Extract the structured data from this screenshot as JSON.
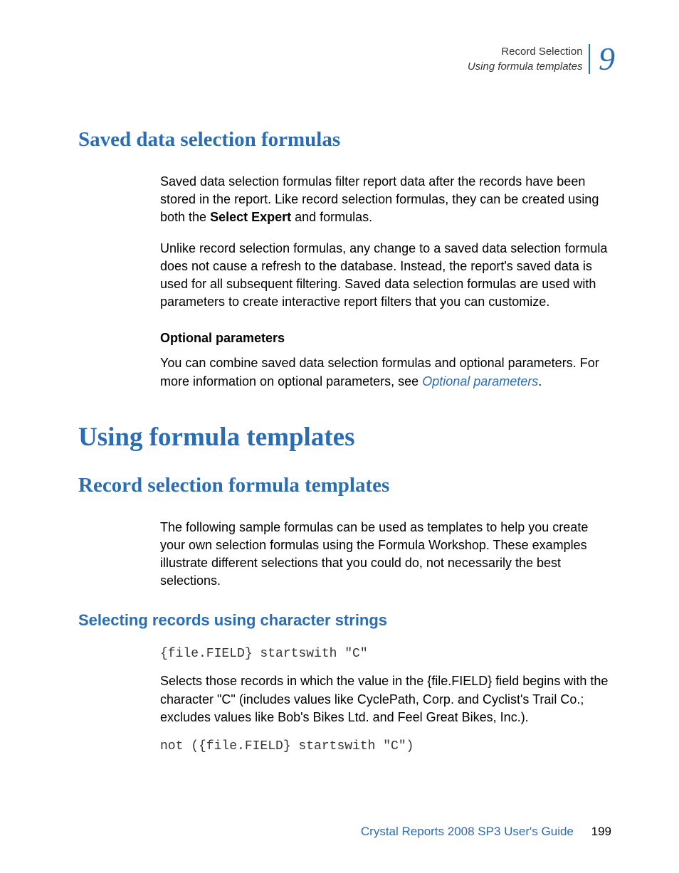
{
  "header": {
    "line1": "Record Selection",
    "line2": "Using formula templates",
    "chapter": "9"
  },
  "section1": {
    "title": "Saved data selection formulas",
    "p1_a": "Saved data selection formulas filter report data after the records have been stored in the report. Like record selection formulas, they can be created using both the ",
    "p1_bold": "Select Expert",
    "p1_b": " and formulas.",
    "p2": "Unlike record selection formulas, any change to a saved data selection formula does not cause a refresh to the database. Instead, the report's saved data is used for all subsequent filtering. Saved data selection formulas are used with parameters to create interactive report filters that you can customize.",
    "sub1": "Optional parameters",
    "p3_a": "You can combine saved data selection formulas and optional parameters. For more information on optional parameters, see ",
    "p3_link": "Optional parameters",
    "p3_b": "."
  },
  "section2": {
    "title": "Using formula templates",
    "subtitle": "Record selection formula templates",
    "p1": "The following sample formulas can be used as templates to help you create your own selection formulas using the Formula Workshop. These examples illustrate different selections that you could do, not necessarily the best selections.",
    "sub1": "Selecting records using character strings",
    "code1": "{file.FIELD} startswith \"C\"",
    "p2": "Selects those records in which the value in the {file.FIELD} field begins with the character \"C\" (includes values like CyclePath, Corp. and Cyclist's Trail Co.; excludes values like Bob's Bikes Ltd. and Feel Great Bikes, Inc.).",
    "code2": "not ({file.FIELD} startswith \"C\")"
  },
  "footer": {
    "text": "Crystal Reports 2008 SP3 User's Guide",
    "page": "199"
  }
}
